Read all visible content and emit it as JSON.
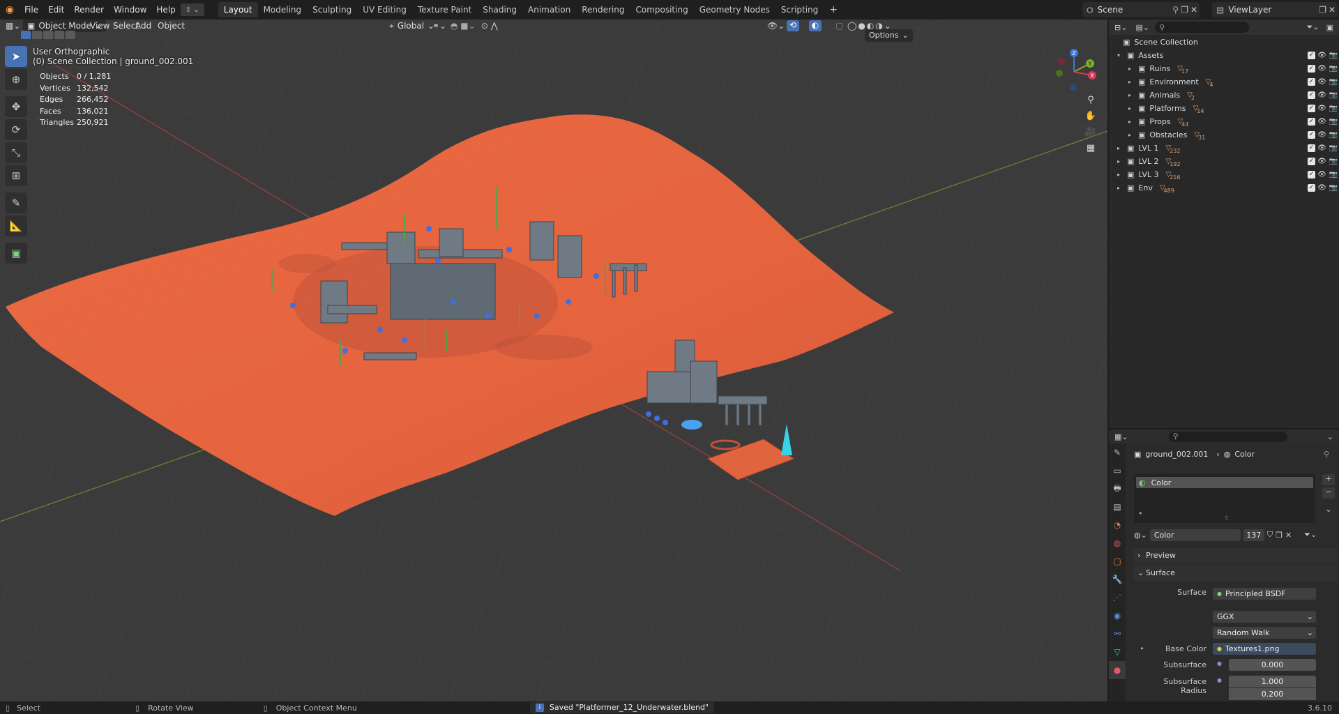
{
  "menu": [
    "File",
    "Edit",
    "Render",
    "Window",
    "Help"
  ],
  "workspaces": [
    "Layout",
    "Modeling",
    "Sculpting",
    "UV Editing",
    "Texture Paint",
    "Shading",
    "Animation",
    "Rendering",
    "Compositing",
    "Geometry Nodes",
    "Scripting"
  ],
  "scene": {
    "label": "Scene",
    "viewlayer": "ViewLayer"
  },
  "viewport": {
    "mode": "Object Mode",
    "menus": [
      "View",
      "Select",
      "Add",
      "Object"
    ],
    "orientation": "Global",
    "options": "Options",
    "view_name": "User Orthographic",
    "context": "(0) Scene Collection | ground_002.001",
    "stats": [
      {
        "k": "Objects",
        "v": "0 / 1,281"
      },
      {
        "k": "Vertices",
        "v": "132,542"
      },
      {
        "k": "Edges",
        "v": "266,452"
      },
      {
        "k": "Faces",
        "v": "136,021"
      },
      {
        "k": "Triangles",
        "v": "250,921"
      }
    ],
    "gizmo": {
      "z": "Z",
      "y": "Y",
      "x": "X"
    }
  },
  "outliner": {
    "root": "Scene Collection",
    "items": [
      {
        "name": "Assets",
        "count": ""
      },
      {
        "name": "Ruins",
        "count": "17"
      },
      {
        "name": "Environment",
        "count": "4"
      },
      {
        "name": "Animals",
        "count": "2"
      },
      {
        "name": "Platforms",
        "count": "14"
      },
      {
        "name": "Props",
        "count": "44"
      },
      {
        "name": "Obstacles",
        "count": "31"
      },
      {
        "name": "LVL 1",
        "count": "232"
      },
      {
        "name": "LVL 2",
        "count": "192"
      },
      {
        "name": "LVL 3",
        "count": "216"
      },
      {
        "name": "Env",
        "count": "489"
      }
    ]
  },
  "properties": {
    "object": "ground_002.001",
    "material_crumb": "Color",
    "slot": "Color",
    "material_name": "Color",
    "users": "137",
    "preview": "Preview",
    "surface_panel": "Surface",
    "surface_label": "Surface",
    "surface_value": "Principled BSDF",
    "distribution": "GGX",
    "subsurface_method": "Random Walk",
    "base_color_label": "Base Color",
    "base_color_value": "Textures1.png",
    "subsurface_label": "Subsurface",
    "subsurface_value": "0.000",
    "subsurface_radius_label": "Subsurface Radius",
    "radius_1": "1.000",
    "radius_2": "0.200"
  },
  "status": {
    "select": "Select",
    "rotate": "Rotate View",
    "context_menu": "Object Context Menu",
    "message": "Saved \"Platformer_12_Underwater.blend\"",
    "version": "3.6.10"
  },
  "colors": {
    "accent": "#4772b3",
    "terrain": "#e8673f",
    "bg": "#3b3b3b"
  }
}
